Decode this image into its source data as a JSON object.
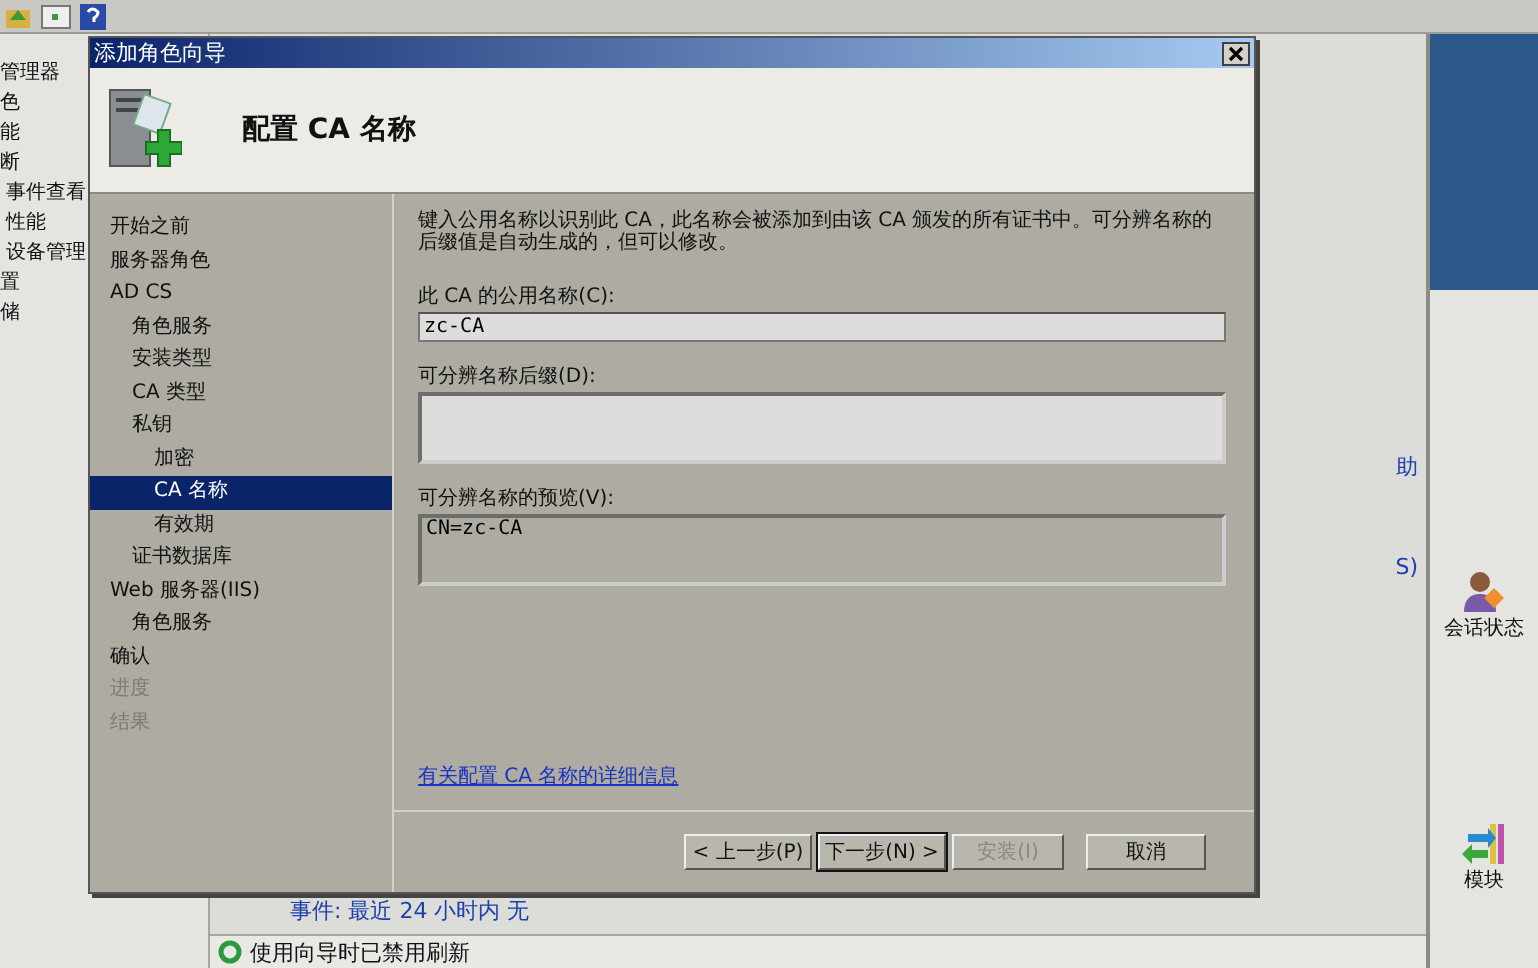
{
  "background": {
    "tree_items": [
      {
        "label": "管理器",
        "indented": false
      },
      {
        "label": "色",
        "indented": false
      },
      {
        "label": "能",
        "indented": false
      },
      {
        "label": "断",
        "indented": false
      },
      {
        "label": "事件查看",
        "indented": true
      },
      {
        "label": "性能",
        "indented": true
      },
      {
        "label": "设备管理",
        "indented": true
      },
      {
        "label": "置",
        "indented": false
      },
      {
        "label": "储",
        "indented": false
      }
    ],
    "events_line": "事件: 最近 24 小时内 无",
    "status_bar": "使用向导时已禁用刷新",
    "side_links": [
      "助",
      "S)"
    ],
    "actions": [
      {
        "label": "会话状态",
        "kind": "session"
      },
      {
        "label": "模块",
        "kind": "modules"
      }
    ]
  },
  "wizard": {
    "title": "添加角色向导",
    "heading": "配置 CA 名称",
    "steps": [
      {
        "label": "开始之前",
        "selected": false,
        "disabled": false
      },
      {
        "label": "服务器角色",
        "selected": false,
        "disabled": false
      },
      {
        "label": "AD CS",
        "selected": false,
        "disabled": false,
        "children": [
          {
            "label": "角色服务",
            "selected": false,
            "disabled": false
          },
          {
            "label": "安装类型",
            "selected": false,
            "disabled": false
          },
          {
            "label": "CA 类型",
            "selected": false,
            "disabled": false
          },
          {
            "label": "私钥",
            "selected": false,
            "disabled": false,
            "children": [
              {
                "label": "加密",
                "selected": false,
                "disabled": false
              },
              {
                "label": "CA 名称",
                "selected": true,
                "disabled": false
              },
              {
                "label": "有效期",
                "selected": false,
                "disabled": false
              }
            ]
          },
          {
            "label": "证书数据库",
            "selected": false,
            "disabled": false
          }
        ]
      },
      {
        "label": "Web 服务器(IIS)",
        "selected": false,
        "disabled": false,
        "children": [
          {
            "label": "角色服务",
            "selected": false,
            "disabled": false
          }
        ]
      },
      {
        "label": "确认",
        "selected": false,
        "disabled": false
      },
      {
        "label": "进度",
        "selected": false,
        "disabled": true
      },
      {
        "label": "结果",
        "selected": false,
        "disabled": true
      }
    ],
    "description": "键入公用名称以识别此 CA，此名称会被添加到由该 CA 颁发的所有证书中。可分辨名称的后缀值是自动生成的，但可以修改。",
    "fields": [
      {
        "label": "此 CA 的公用名称(C):",
        "value": "zc-CA",
        "kind": "single"
      },
      {
        "label": "可分辨名称后缀(D):",
        "kind": "multi"
      },
      {
        "label": "可分辨名称的预览(V):",
        "value": "CN=zc-CA",
        "kind": "preview"
      }
    ],
    "help_link": "有关配置 CA 名称的详细信息",
    "buttons": [
      {
        "label": "< 上一步(P)",
        "disabled": false,
        "default": false
      },
      {
        "label": "下一步(N) >",
        "disabled": false,
        "default": true
      },
      {
        "label": "安装(I)",
        "disabled": true,
        "default": false
      },
      {
        "label": "取消",
        "disabled": false,
        "default": false
      }
    ]
  }
}
